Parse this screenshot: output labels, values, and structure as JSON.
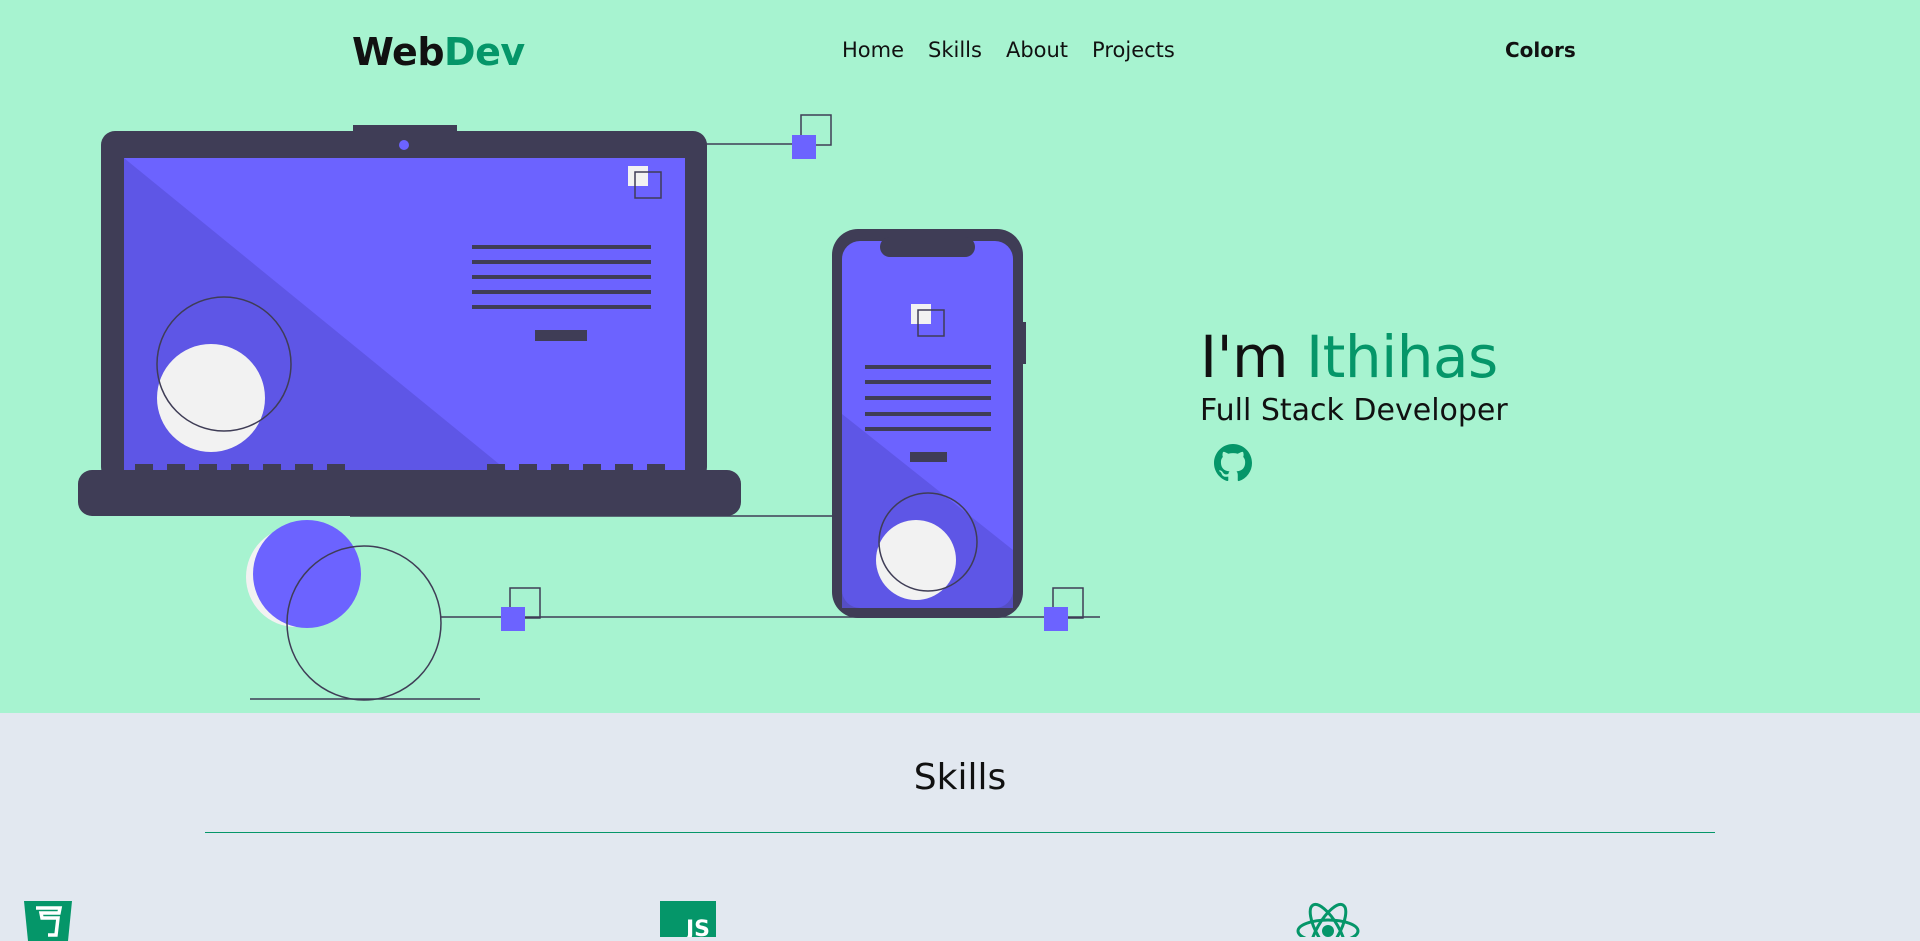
{
  "header": {
    "logo_primary": "Web",
    "logo_accent": "Dev",
    "nav": [
      "Home",
      "Skills",
      "About",
      "Projects"
    ],
    "colors_label": "Colors"
  },
  "hero": {
    "greeting": "I'm",
    "name": "Ithihas",
    "role": "Full Stack Developer",
    "social_icon": "github-icon"
  },
  "skills": {
    "title": "Skills",
    "icons": [
      "html5-icon",
      "javascript-icon",
      "react-icon"
    ],
    "js_badge_text": "JS"
  },
  "colors": {
    "hero_bg": "#a7f3d0",
    "accent": "#059669",
    "device_dark": "#3f3d56",
    "screen_purple": "#6c63ff",
    "skills_bg": "#e2e8f0"
  }
}
